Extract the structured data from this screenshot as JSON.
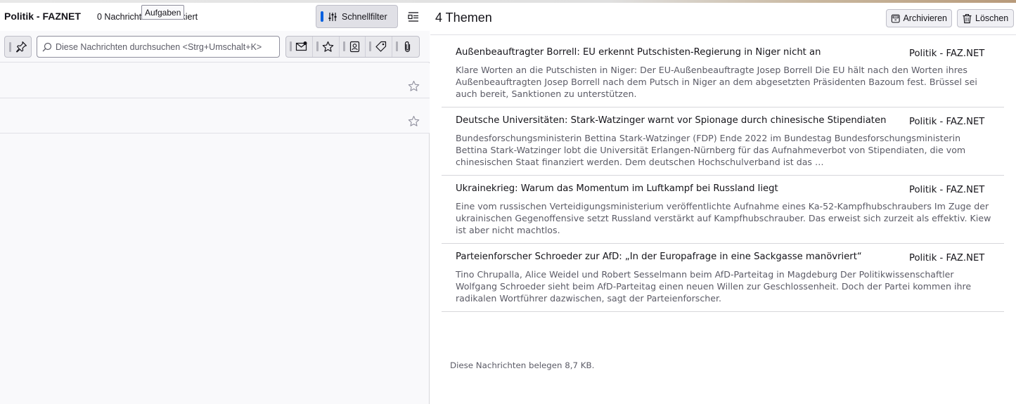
{
  "left_panel": {
    "folder_name": "Politik - FAZNET",
    "message_count": "0 Nachrichten",
    "marked_count": "markiert",
    "tooltip": "Aufgaben",
    "quick_filter_label": "Schnellfilter",
    "search_placeholder": "Diese Nachrichten durchsuchen <Strg+Umschalt+K>",
    "filter_buttons": [
      "pin-icon",
      "unread-icon",
      "star-icon",
      "contact-icon",
      "tag-icon",
      "attachment-icon"
    ],
    "rows": [
      {
        "starred": false
      },
      {
        "starred": false
      }
    ]
  },
  "right_panel": {
    "topics_count": "4 Themen",
    "archive_label": "Archivieren",
    "delete_label": "Löschen",
    "threads": [
      {
        "subject": "Außenbeauftragter Borrell: EU erkennt Putschisten-Regierung in Niger nicht an",
        "source": "Politik - FAZ.NET",
        "preview": "Klare Worten an die Putschisten in Niger: Der EU-Außenbeauftragte Josep Borrell Die EU hält nach den Worten ihres Außenbeauftragten Josep Borrell nach dem Putsch in Niger an dem abgesetzten Präsidenten Bazoum fest. Brüssel sei auch bereit, Sanktionen zu unterstützen."
      },
      {
        "subject": "Deutsche Universitäten: Stark-Watzinger warnt vor Spionage durch chinesische Stipendiaten",
        "source": "Politik - FAZ.NET",
        "preview": "Bundesforschungsministerin Bettina Stark-Watzinger (FDP) Ende 2022 im Bundestag Bundesforschungsministerin Bettina Stark-Watzinger lobt die Universität Erlangen-Nürnberg für das Aufnahmeverbot von Stipendiaten, die vom chinesischen Staat finanziert werden. Dem deutschen Hochschulverband ist das …"
      },
      {
        "subject": "Ukrainekrieg: Warum das Momentum im Luftkampf bei Russland liegt",
        "source": "Politik - FAZ.NET",
        "preview": "Eine vom russischen Verteidigungsministerium veröffentlichte Aufnahme eines Ka-52-Kampfhubschraubers Im Zuge der ukrainischen Gegenoffensive setzt Russland verstärkt auf Kampfhubschrauber. Das erweist sich zurzeit als effektiv. Kiew ist aber nicht machtlos."
      },
      {
        "subject": "Parteienforscher Schroeder zur AfD: „In der Europafrage in eine Sackgasse manövriert“",
        "source": "Politik - FAZ.NET",
        "preview": "Tino Chrupalla, Alice Weidel und Robert Sesselmann beim AfD-Parteitag in Magdeburg Der Politikwissenschaftler Wolfgang Schroeder sieht beim AfD-Parteitag einen neuen Willen zur Geschlossenheit. Doch der Partei kommen ihre radikalen Wortführer dazwischen, sagt der Parteienforscher."
      }
    ],
    "size_note": "Diese Nachrichten belegen 8,7 KB."
  }
}
